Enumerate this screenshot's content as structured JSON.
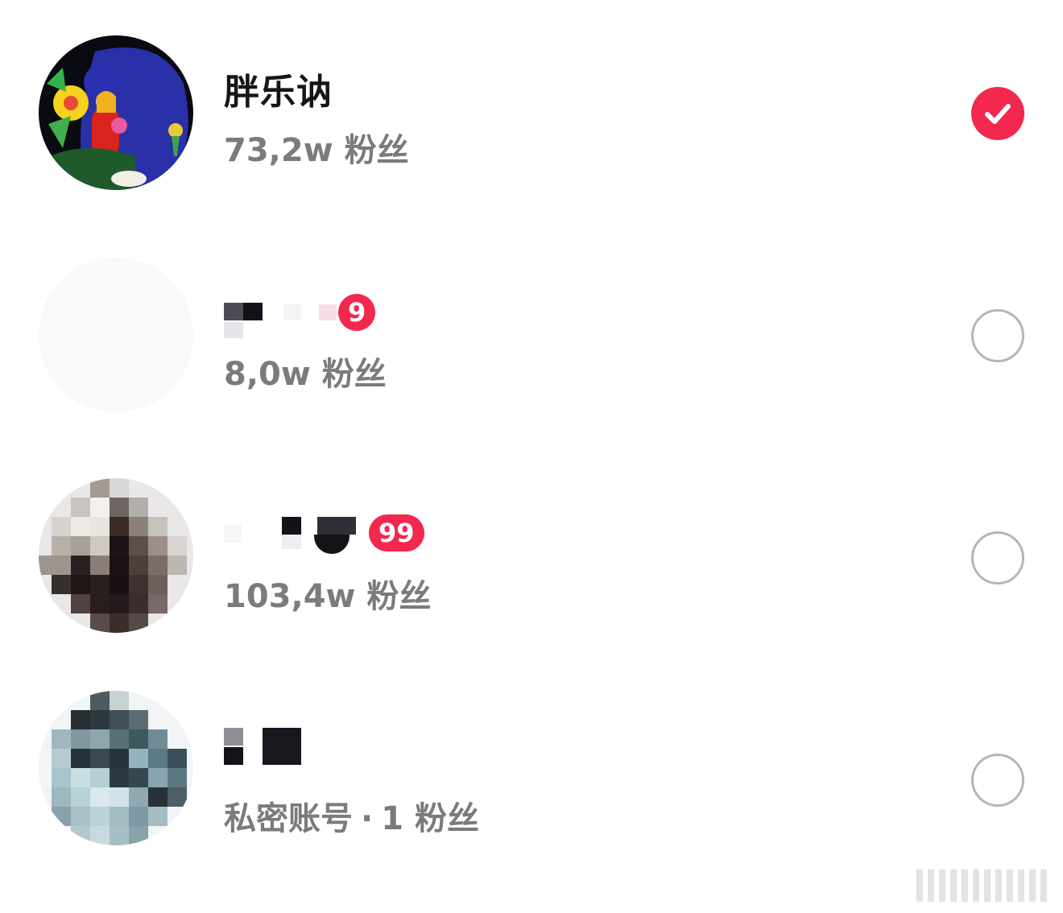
{
  "accounts": [
    {
      "name": "胖乐讷",
      "followers_text": "73,2w 粉丝",
      "selected": true,
      "badge": "",
      "avatar_icon": "colorful-illustration-avatar"
    },
    {
      "name": "",
      "followers_text": "8,0w 粉丝",
      "selected": false,
      "badge": "9",
      "avatar_icon": "blurred-avatar"
    },
    {
      "name": "",
      "followers_text": "103,4w 粉丝",
      "selected": false,
      "badge": "99",
      "avatar_icon": "pixelated-avatar"
    },
    {
      "name": "",
      "followers_text": "1 粉丝",
      "private_label": "私密账号",
      "separator": "·",
      "selected": false,
      "badge": "",
      "avatar_icon": "pixelated-avatar"
    }
  ],
  "colors": {
    "accent": "#f2284f",
    "name": "#161616",
    "meta": "#7b7b7b",
    "radio_border": "#b6b6b6"
  }
}
